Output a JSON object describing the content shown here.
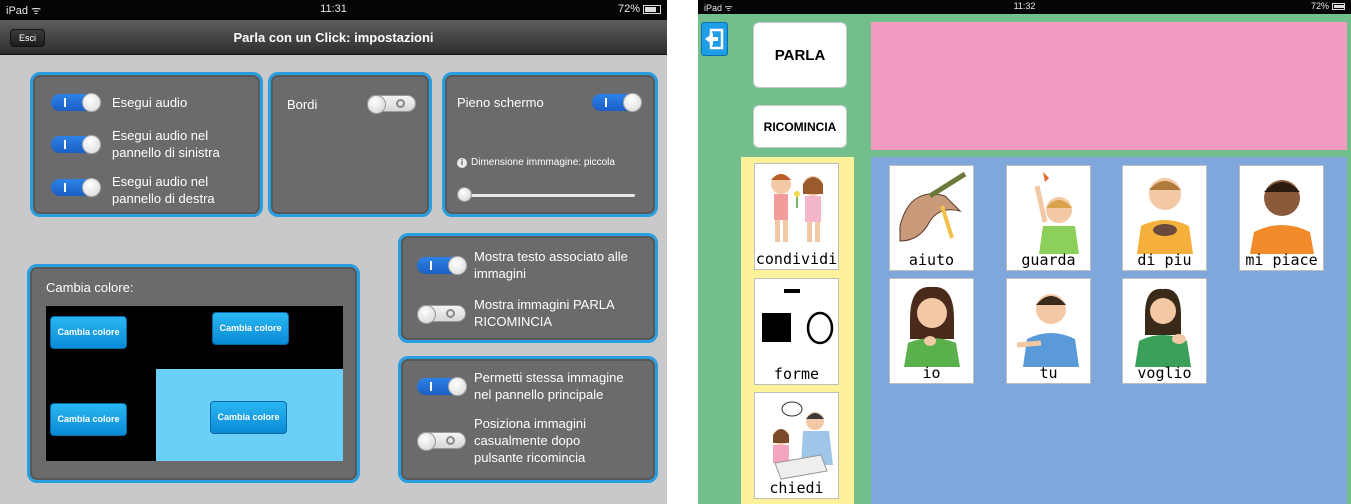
{
  "left": {
    "status": {
      "device": "iPad ᯤ",
      "time": "11:31",
      "battery": "72%"
    },
    "nav": {
      "back_label": "Esci",
      "title": "Parla con un Click: impostazioni"
    },
    "audio_panel": {
      "items": [
        {
          "label": "Esegui audio",
          "on": true
        },
        {
          "label": "Esegui audio nel\npannello di sinistra",
          "on": true
        },
        {
          "label": "Esegui audio nel\npannello di destra",
          "on": true
        }
      ]
    },
    "border_panel": {
      "label": "Bordi",
      "on": false
    },
    "fullscreen_panel": {
      "label": "Pieno schermo",
      "on": true,
      "size_label": "Dimensione immmagine: piccola",
      "size_level": 0
    },
    "text_panel": {
      "items": [
        {
          "label": "Mostra testo associato alle\nimmagini",
          "on": true
        },
        {
          "label": "Mostra immagini PARLA\nRICOMINCIA",
          "on": false
        }
      ]
    },
    "random_panel": {
      "items": [
        {
          "label": "Permetti stessa immagine\nnel pannello principale",
          "on": true
        },
        {
          "label": "Posiziona immagini\ncasualmente dopo\npulsante ricomincia",
          "on": false
        }
      ]
    },
    "color_panel": {
      "title": "Cambia colore:",
      "button_label": "Cambia colore",
      "area_colors": {
        "background": "#000000",
        "highlight": "#6bd0f7"
      }
    },
    "colors": {
      "accent": "#2a9fe0",
      "panel": "#6b6b6d",
      "toggle_on": "#1a6fd6"
    }
  },
  "right": {
    "status": {
      "device": "iPad ᯤ",
      "time": "11:32",
      "battery": "72%"
    },
    "buttons": {
      "speak": "PARLA",
      "restart": "RICOMINCIA"
    },
    "left_column": [
      "condividi",
      "forme",
      "chiedi"
    ],
    "grid": [
      "aiuto",
      "guarda",
      "di piu",
      "mi piace",
      "io",
      "tu",
      "voglio"
    ],
    "colors": {
      "background": "#72bf8c",
      "sentence_bar": "#f39bc0",
      "column": "#fdf29a",
      "grid": "#80a7dc",
      "exit": "#1e9ee6"
    }
  }
}
